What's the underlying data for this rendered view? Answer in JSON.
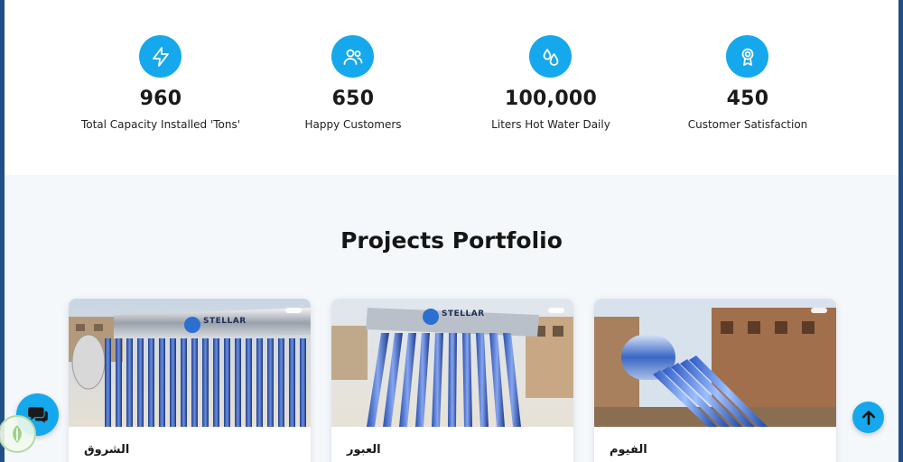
{
  "stats": [
    {
      "icon": "bolt-icon",
      "value": "960",
      "label": "Total Capacity Installed 'Tons'"
    },
    {
      "icon": "users-icon",
      "value": "650",
      "label": "Happy Customers"
    },
    {
      "icon": "water-drops-icon",
      "value": "100,000",
      "label": "Liters Hot Water Daily"
    },
    {
      "icon": "award-ribbon-icon",
      "value": "450",
      "label": "Customer Satisfaction"
    }
  ],
  "portfolio": {
    "title": "Projects Portfolio",
    "projects": [
      {
        "name": "الشروق",
        "brand": "STELLAR"
      },
      {
        "name": "العبور",
        "brand": "STELLAR"
      },
      {
        "name": "الفيوم",
        "brand": ""
      }
    ]
  },
  "colors": {
    "accent": "#15a8ec",
    "page_bg": "#f5f8fb",
    "stats_bg": "#ffffff",
    "frame": "#1f4f86"
  },
  "floating": {
    "chat_icon": "chat-bubbles-icon",
    "scroll_top_icon": "arrow-up-icon"
  }
}
